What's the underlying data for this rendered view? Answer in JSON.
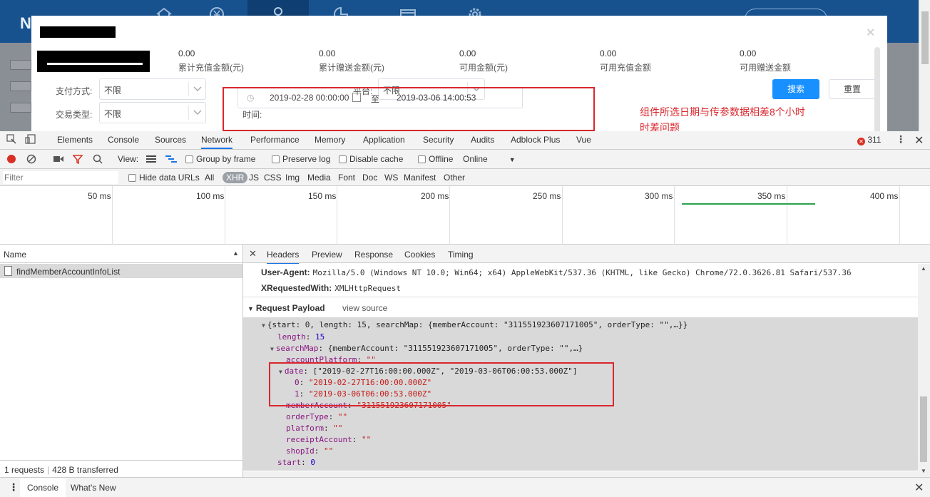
{
  "modal": {
    "stats": [
      {
        "value": "0.00",
        "label": "累计充值金额(元)"
      },
      {
        "value": "0.00",
        "label": "累计赠送金额(元)"
      },
      {
        "value": "0.00",
        "label": "可用金额(元)"
      },
      {
        "value": "0.00",
        "label": "可用充值金额"
      },
      {
        "value": "0.00",
        "label": "可用赠送金额"
      }
    ],
    "pay_method_label": "支付方式:",
    "pay_method_value": "不限",
    "trade_type_label": "交易类型:",
    "trade_type_value": "不限",
    "platform_label": "平台:",
    "platform_value": "不限",
    "time_label": "时间:",
    "date_from": "2019-02-28 00:00:00",
    "date_sep": "至",
    "date_to": "2019-03-06 14:00:53",
    "search_label": "搜索",
    "reset_label": "重置",
    "close_glyph": "✕"
  },
  "annotation": {
    "line1": "组件所选日期与传参数据相差8个小时",
    "line2": "时差问题",
    "color": "#d9272d"
  },
  "devtools": {
    "tabs": [
      "Elements",
      "Console",
      "Sources",
      "Network",
      "Performance",
      "Memory",
      "Application",
      "Security",
      "Audits",
      "Adblock Plus",
      "Vue"
    ],
    "active_tab": "Network",
    "error_count": "311",
    "toolbar": {
      "view_label": "View:",
      "group_by_frame": "Group by frame",
      "preserve_log": "Preserve log",
      "disable_cache": "Disable cache",
      "offline": "Offline",
      "throttle": "Online"
    },
    "filter": {
      "placeholder": "Filter",
      "hide_data_urls": "Hide data URLs",
      "types": [
        "All",
        "XHR",
        "JS",
        "CSS",
        "Img",
        "Media",
        "Font",
        "Doc",
        "WS",
        "Manifest",
        "Other"
      ],
      "active_type": "XHR"
    },
    "timeline": {
      "ticks": [
        "50 ms",
        "100 ms",
        "150 ms",
        "200 ms",
        "250 ms",
        "300 ms",
        "350 ms",
        "400 ms"
      ]
    },
    "requests": {
      "column": "Name",
      "items": [
        "findMemberAccountInfoList"
      ],
      "status_requests": "1 requests",
      "status_transferred": "428 B transferred"
    },
    "detail_tabs": [
      "Headers",
      "Preview",
      "Response",
      "Cookies",
      "Timing"
    ],
    "active_detail_tab": "Headers",
    "headers": {
      "user_agent_key": "User-Agent:",
      "user_agent_value": "Mozilla/5.0 (Windows NT 10.0; Win64; x64) AppleWebKit/537.36 (KHTML, like Gecko) Chrome/72.0.3626.81 Safari/537.36",
      "xrw_key": "XRequestedWith:",
      "xrw_value": "XMLHttpRequest"
    },
    "payload": {
      "title": "Request Payload",
      "view_source": "view source",
      "root_summary": "{start: 0, length: 15, searchMap: {memberAccount: \"311551923607171005\", orderType: \"\",…}}",
      "length_key": "length",
      "length_value": "15",
      "searchmap_key": "searchMap",
      "searchmap_summary": "{memberAccount: \"311551923607171005\", orderType: \"\",…}",
      "account_platform_key": "accountPlatform",
      "account_platform_value": "\"\"",
      "date_key": "date",
      "date_summary": "[\"2019-02-27T16:00:00.000Z\", \"2019-03-06T06:00:53.000Z\"]",
      "date_0_key": "0",
      "date_0_value": "\"2019-02-27T16:00:00.000Z\"",
      "date_1_key": "1",
      "date_1_value": "\"2019-03-06T06:00:53.000Z\"",
      "member_account_key": "memberAccount",
      "member_account_value": "\"311551923607171005\"",
      "order_type_key": "orderType",
      "order_type_value": "\"\"",
      "platform_key": "platform",
      "platform_value": "\"\"",
      "receipt_account_key": "receiptAccount",
      "receipt_account_value": "\"\"",
      "shop_id_key": "shopId",
      "shop_id_value": "\"\"",
      "start_key": "start",
      "start_value": "0"
    },
    "drawer_tabs": [
      "Console",
      "What's New"
    ]
  }
}
